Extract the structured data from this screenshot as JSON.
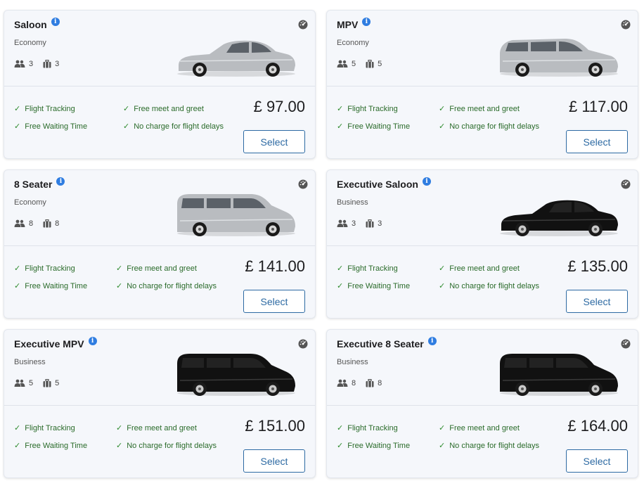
{
  "colors": {
    "card_bg": "#f5f7fb",
    "accent_blue": "#2d6aa3",
    "info_blue": "#2f7de1",
    "feature_green": "#2a6b2a"
  },
  "cars": [
    {
      "name": "Saloon",
      "category": "Economy",
      "passengers": "3",
      "luggage": "3",
      "price": "£ 97.00",
      "car_color": "silver",
      "car_shape": "sedan",
      "features": [
        "Flight Tracking",
        "Free meet and greet",
        "Free Waiting Time",
        "No charge for flight delays"
      ],
      "select_label": "Select"
    },
    {
      "name": "MPV",
      "category": "Economy",
      "passengers": "5",
      "luggage": "5",
      "price": "£ 117.00",
      "car_color": "silver",
      "car_shape": "mpv",
      "features": [
        "Flight Tracking",
        "Free meet and greet",
        "Free Waiting Time",
        "No charge for flight delays"
      ],
      "select_label": "Select"
    },
    {
      "name": "8 Seater",
      "category": "Economy",
      "passengers": "8",
      "luggage": "8",
      "price": "£ 141.00",
      "car_color": "silver",
      "car_shape": "van",
      "features": [
        "Flight Tracking",
        "Free meet and greet",
        "Free Waiting Time",
        "No charge for flight delays"
      ],
      "select_label": "Select"
    },
    {
      "name": "Executive Saloon",
      "category": "Business",
      "passengers": "3",
      "luggage": "3",
      "price": "£ 135.00",
      "car_color": "black",
      "car_shape": "sedan",
      "features": [
        "Flight Tracking",
        "Free meet and greet",
        "Free Waiting Time",
        "No charge for flight delays"
      ],
      "select_label": "Select"
    },
    {
      "name": "Executive MPV",
      "category": "Business",
      "passengers": "5",
      "luggage": "5",
      "price": "£ 151.00",
      "car_color": "black",
      "car_shape": "van",
      "features": [
        "Flight Tracking",
        "Free meet and greet",
        "Free Waiting Time",
        "No charge for flight delays"
      ],
      "select_label": "Select"
    },
    {
      "name": "Executive 8 Seater",
      "category": "Business",
      "passengers": "8",
      "luggage": "8",
      "price": "£ 164.00",
      "car_color": "black",
      "car_shape": "van",
      "features": [
        "Flight Tracking",
        "Free meet and greet",
        "Free Waiting Time",
        "No charge for flight delays"
      ],
      "select_label": "Select"
    }
  ]
}
